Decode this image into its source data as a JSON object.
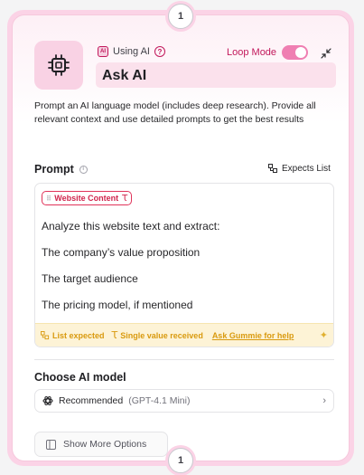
{
  "step_top": "1",
  "step_bottom": "1",
  "header": {
    "using_label": "Using AI",
    "ai_badge": "AI",
    "loop_mode_label": "Loop Mode",
    "loop_mode_on": true,
    "title": "Ask AI"
  },
  "description": "Prompt an AI language model (includes deep research). Provide all relevant context and use detailed prompts to get the best results",
  "prompt": {
    "label": "Prompt",
    "expects_list_label": "Expects List",
    "variable_chip": "Website Content",
    "lines": [
      "Analyze this website text and extract:",
      "The company’s value proposition",
      "The target audience",
      "The pricing model, if mentioned"
    ],
    "footer": {
      "list_expected": "List expected",
      "single_value": "Single value received",
      "help_link": "Ask Gummie for help"
    }
  },
  "model": {
    "label": "Choose AI model",
    "selected": "Recommended",
    "selected_detail": "(GPT-4.1 Mini)"
  },
  "show_more_label": "Show More Options",
  "colors": {
    "accent": "#c2185b",
    "card_border": "#fbd3e6",
    "warning": "#d99a0f",
    "chip": "#e0345a"
  }
}
